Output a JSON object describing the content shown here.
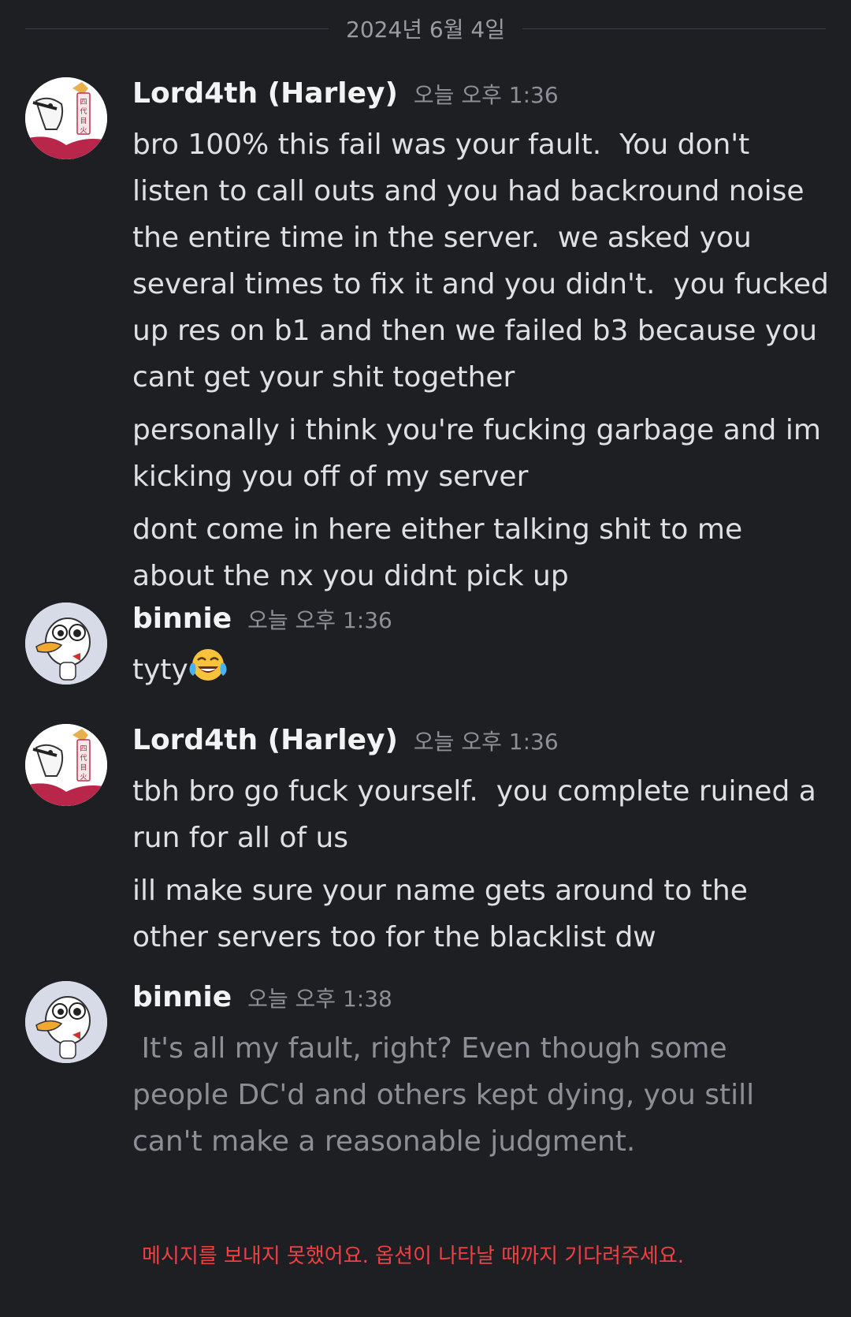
{
  "date_divider": "2024년 6월 4일",
  "messages": [
    {
      "author": "Lord4th (Harley)",
      "time": "오늘 오후 1:36",
      "lines": [
        "bro 100% this fail was your fault.  You don't listen to call outs and you had backround noise the entire time in the server.  we asked you several times to fix it and you didn't.  you fucked up res on b1 and then we failed b3 because you cant get your shit together",
        "personally i think you're fucking garbage and im kicking you off of my server",
        "dont come in here either talking shit to me about the nx you didnt pick up"
      ]
    },
    {
      "author": "binnie",
      "time": "오늘 오후 1:36",
      "text": "tyty",
      "emoji": "face-with-tears-of-joy"
    },
    {
      "author": "Lord4th (Harley)",
      "time": "오늘 오후 1:36",
      "lines": [
        "tbh bro go fuck yourself.  you complete ruined a run for all of us",
        "ill make sure your name gets around to the other servers too for the blacklist dw"
      ]
    },
    {
      "author": "binnie",
      "time": "오늘 오후 1:38",
      "text": " It's all my fault, right? Even though some people DC'd and others kept dying, you still can't make a reasonable judgment."
    }
  ],
  "error_notice": "메시지를 보내지 못했어요. 옵션이 나타날 때까지 기다려주세요.",
  "colors": {
    "background": "#1e1f23",
    "error": "#f23f43",
    "pending_text": "#8d8f96"
  }
}
